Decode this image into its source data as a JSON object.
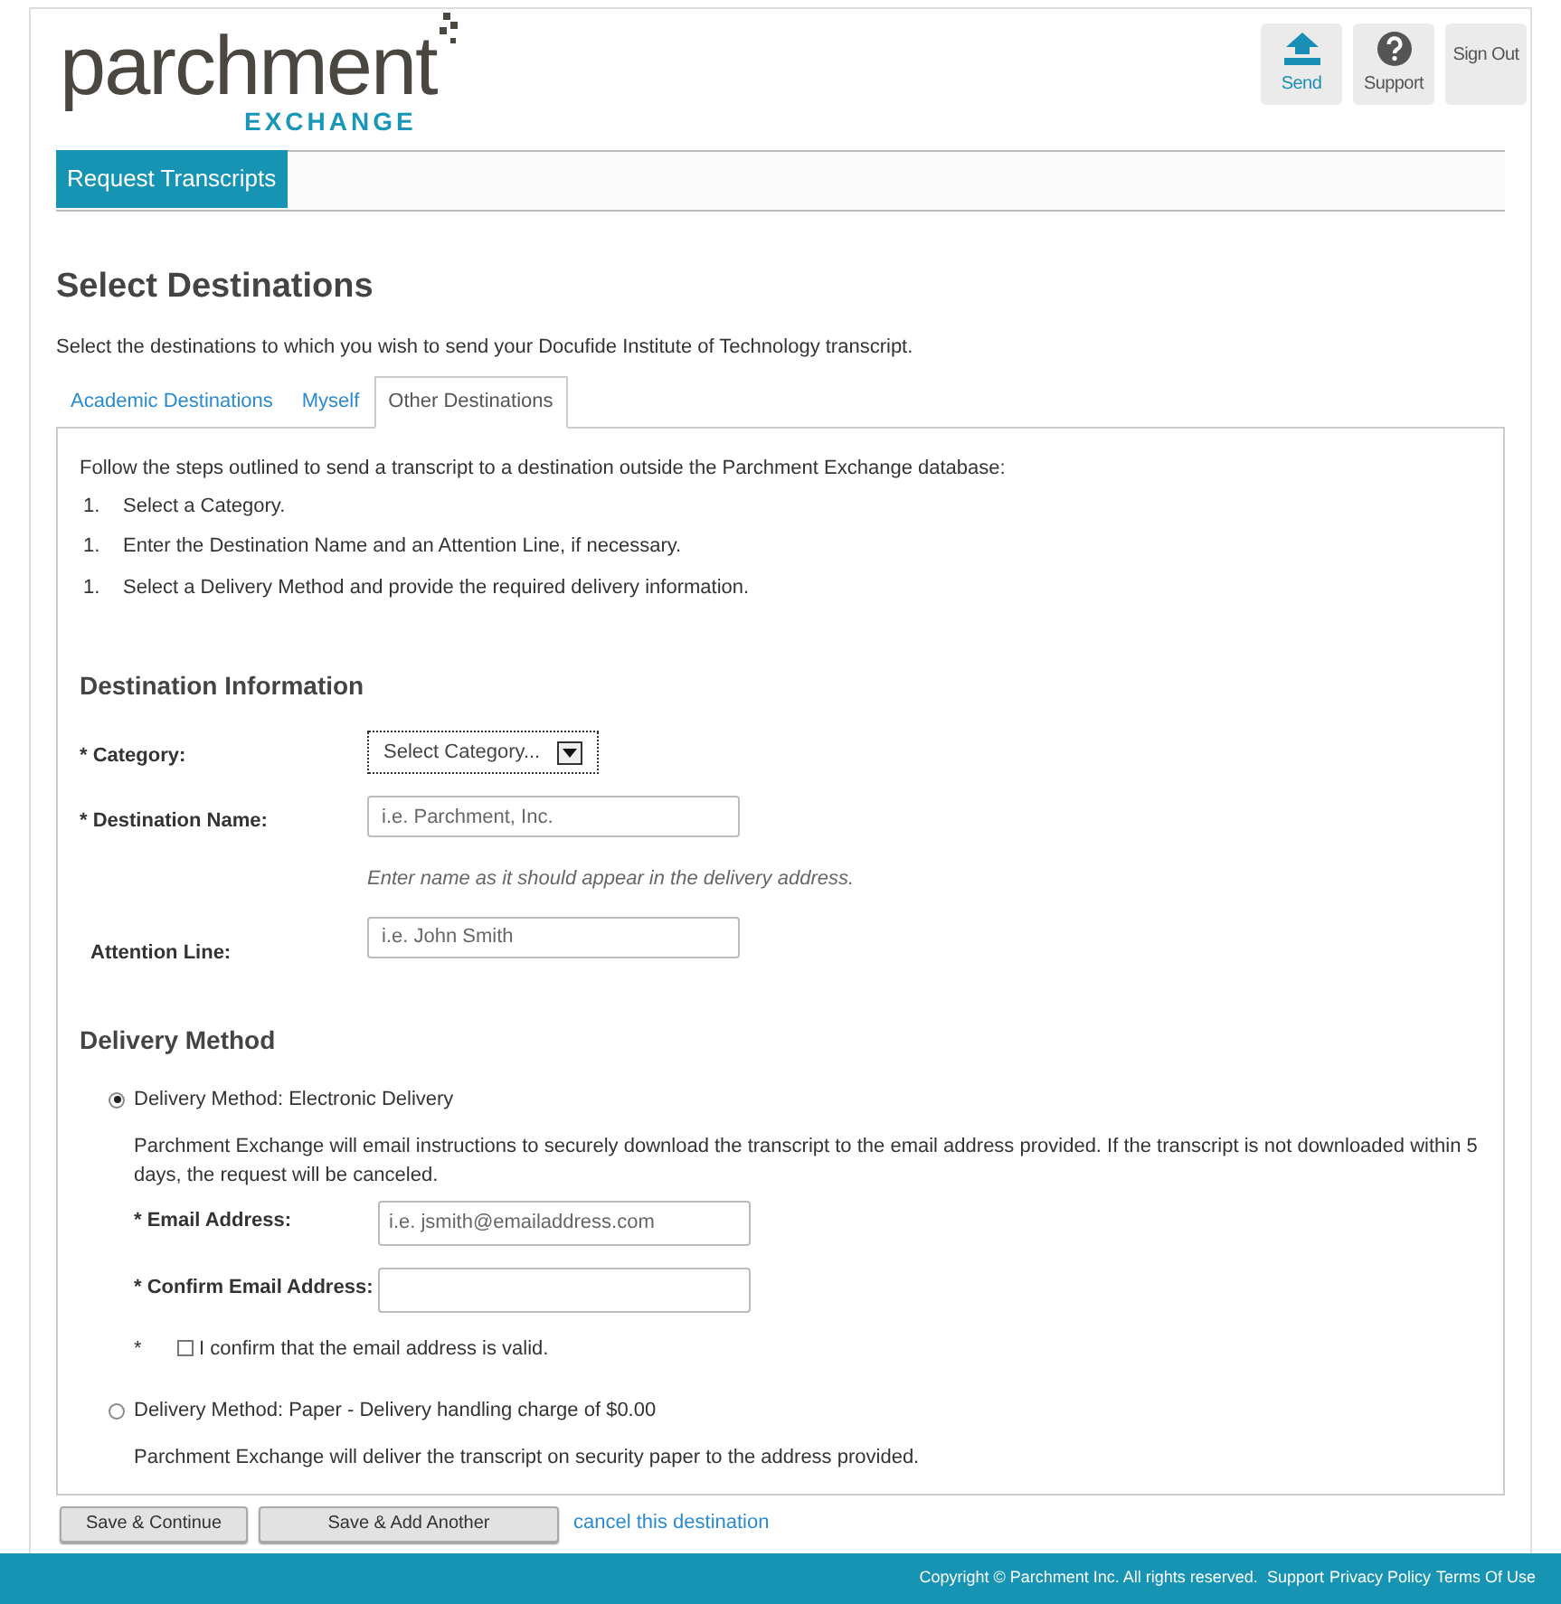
{
  "logo": {
    "name": "parchment",
    "sub": "EXCHANGE"
  },
  "header_buttons": [
    {
      "kind": "send",
      "label": "Send"
    },
    {
      "kind": "support",
      "label": "Support"
    },
    {
      "kind": "signout",
      "label": "Sign Out"
    }
  ],
  "nav": [
    {
      "label": "Request Transcripts",
      "selected": true
    }
  ],
  "title": "Select Destinations",
  "intro": "Select the destinations to which you wish to send your Docufide Institute of Technology transcript.",
  "tabs": [
    {
      "label": "Academic Destinations",
      "selected": false
    },
    {
      "label": "Myself",
      "selected": false
    },
    {
      "label": "Other Destinations",
      "selected": true
    }
  ],
  "instructions": "Follow the steps outlined to send a transcript to a destination outside the Parchment Exchange database:",
  "steps": [
    {
      "number": "1.",
      "text": "Select a Category."
    },
    {
      "number": "1.",
      "text": "Enter the Destination Name and an Attention Line, if necessary."
    },
    {
      "number": "1.",
      "text": "Select a Delivery Method and provide the required delivery information."
    }
  ],
  "destination_section": {
    "heading": "Destination Information",
    "fields": [
      {
        "kind": "select",
        "label": "* Category:",
        "value": "Select Category..."
      },
      {
        "kind": "text",
        "label": "* Destination Name:",
        "placeholder": "i.e. Parchment, Inc.",
        "hint": "Enter name as it should appear in the delivery address."
      },
      {
        "kind": "text",
        "label": "Attention Line:",
        "placeholder": "i.e. John Smith"
      }
    ]
  },
  "delivery_section": {
    "heading": "Delivery Method",
    "options": [
      {
        "label": "Delivery Method: Electronic Delivery",
        "selected": true,
        "description": "Parchment Exchange will email instructions to securely download the transcript to the email address provided. If the transcript is not downloaded within 5 days, the request will be canceled.",
        "fields": [
          {
            "label": "* Email Address:",
            "placeholder": "i.e. jsmith@emailaddress.com"
          },
          {
            "label": "* Confirm Email Address:"
          }
        ],
        "confirm": {
          "mark": "*",
          "label": "I confirm that the email address is valid.",
          "checked": false
        }
      },
      {
        "label": "Delivery Method: Paper - Delivery handling charge of $0.00",
        "selected": false,
        "description": "Parchment Exchange will deliver the transcript on security paper to the address provided."
      }
    ]
  },
  "actions": {
    "buttons": [
      "Save & Continue",
      "Save & Add Another"
    ],
    "link": "cancel this destination"
  },
  "footer": {
    "copyright": "Copyright © Parchment Inc. All rights reserved.",
    "links": [
      "Support",
      "Privacy Policy",
      "Terms Of Use"
    ]
  }
}
